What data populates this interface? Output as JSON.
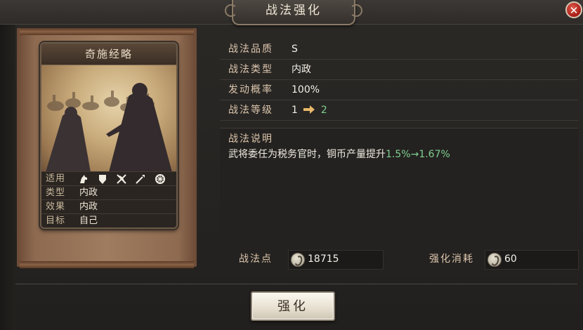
{
  "window": {
    "title": "战法强化"
  },
  "close_glyph": "✕",
  "card": {
    "name": "奇施经略",
    "labels": {
      "applicable": "适用",
      "type": "类型",
      "effect": "效果",
      "target": "目标"
    },
    "type_value": "内政",
    "effect_value": "内政",
    "target_value": "自己",
    "applicable_icons": [
      "cavalry-icon",
      "shield-icon",
      "bow-icon",
      "spear-icon",
      "wheel-icon"
    ]
  },
  "details": {
    "quality": {
      "label": "战法品质",
      "value": "S"
    },
    "type": {
      "label": "战法类型",
      "value": "内政"
    },
    "chance": {
      "label": "发动概率",
      "value": "100%"
    },
    "level": {
      "label": "战法等级",
      "from": "1",
      "to": "2"
    },
    "description": {
      "label": "战法说明",
      "text": "武将委任为税务官时，铜币产量提升",
      "from_value": "1.5%",
      "arrow": "→",
      "to_value": "1.67%"
    }
  },
  "points": {
    "label": "战法点",
    "value": "18715"
  },
  "cost": {
    "label": "强化消耗",
    "value": "60"
  },
  "action_button": "强化",
  "colors": {
    "accent_green": "#7fcf8f",
    "label_tan": "#dcc6ad",
    "close_red": "#b3241b"
  }
}
